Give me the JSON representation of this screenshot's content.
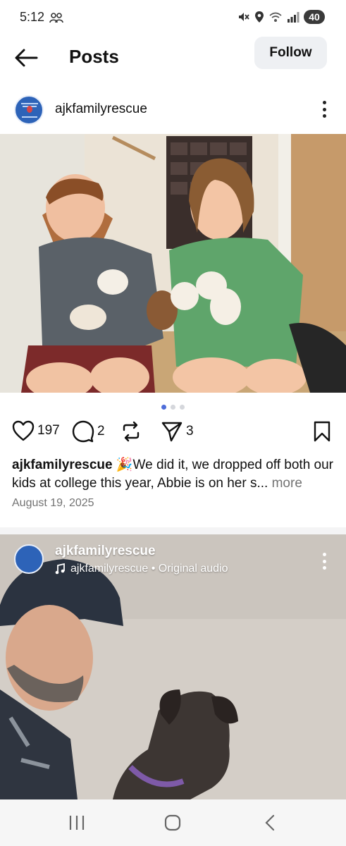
{
  "status_bar": {
    "time": "5:12",
    "battery": "40",
    "icons": [
      "people-icon",
      "mute-icon",
      "location-icon",
      "wifi-icon",
      "signal-icon",
      "battery-icon"
    ]
  },
  "header": {
    "title": "Posts",
    "follow_label": "Follow",
    "back_icon": "back-arrow-icon"
  },
  "posts": [
    {
      "username": "ajkfamilyrescue",
      "image_count": 3,
      "active_image": 1,
      "likes": "197",
      "comments": "2",
      "shares": "3",
      "caption_user": "ajkfamilyrescue",
      "caption_text": " 🎉We did it, we dropped off both our kids at college this year, Abbie is on her s...",
      "caption_more": " more",
      "date": "August 19, 2025"
    },
    {
      "username": "ajkfamilyrescue",
      "audio": "ajkfamilyrescue • Original audio"
    }
  ],
  "nav": {
    "icons": [
      "recent-apps-icon",
      "home-icon",
      "back-icon"
    ]
  },
  "colors": {
    "follow_bg": "#eef0f3",
    "dot_active": "#4e6dd9",
    "muted_text": "#737373",
    "avatar_blue": "#2d63b8"
  }
}
